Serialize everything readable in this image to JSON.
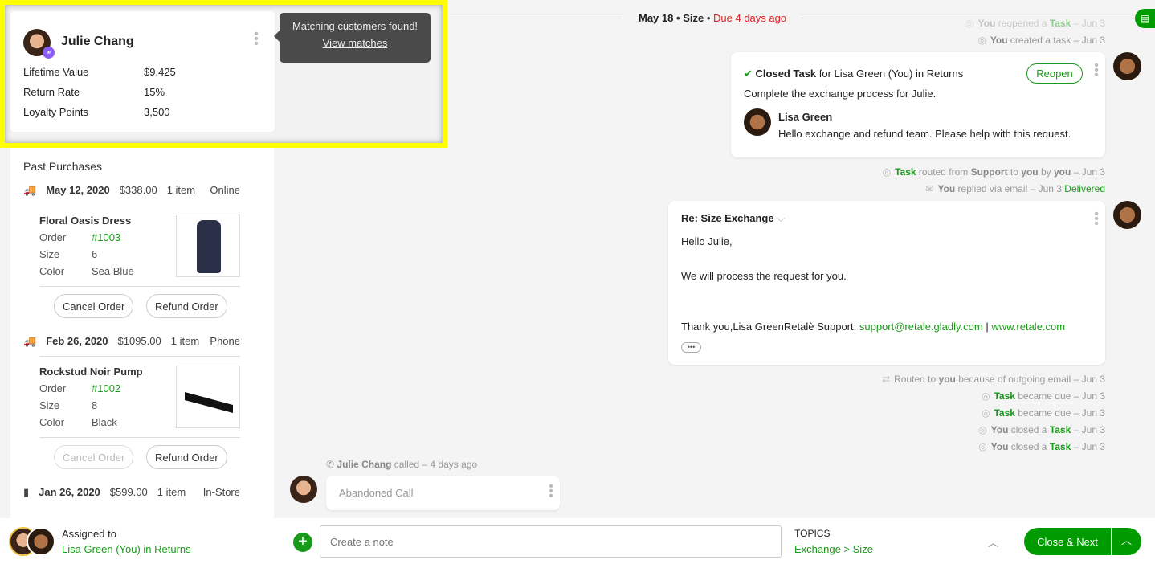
{
  "customer": {
    "name": "Julie Chang",
    "fields": [
      {
        "label": "Lifetime Value",
        "value": "$9,425"
      },
      {
        "label": "Return Rate",
        "value": "15%"
      },
      {
        "label": "Loyalty Points",
        "value": "3,500"
      }
    ]
  },
  "tooltip": {
    "text": "Matching customers found!",
    "link": "View matches"
  },
  "purchases": {
    "title": "Past Purchases",
    "orders": [
      {
        "date": "May 12, 2020",
        "amount": "$338.00",
        "count": "1 item",
        "channel": "Online",
        "icon": "truck-icon",
        "item": "Floral Oasis Dress",
        "order_label": "Order",
        "order": "#1003",
        "size_label": "Size",
        "size": "6",
        "color_label": "Color",
        "color": "Sea Blue",
        "cancel": "Cancel Order",
        "refund": "Refund Order"
      },
      {
        "date": "Feb 26, 2020",
        "amount": "$1095.00",
        "count": "1 item",
        "channel": "Phone",
        "icon": "truck-icon",
        "item": "Rockstud Noir Pump",
        "order_label": "Order",
        "order": "#1002",
        "size_label": "Size",
        "size": "8",
        "color_label": "Color",
        "color": "Black",
        "cancel": "Cancel Order",
        "refund": "Refund Order"
      },
      {
        "date": "Jan 26, 2020",
        "amount": "$599.00",
        "count": "1 item",
        "channel": "In-Store",
        "icon": "store-icon"
      }
    ]
  },
  "header": {
    "date": "May 18",
    "sep": "•",
    "topic": "Size",
    "due": "Due 4 days ago"
  },
  "timeline_top": [
    [
      [
        "b",
        "You"
      ],
      [
        "t",
        " reopened a "
      ],
      [
        "g",
        "Task"
      ],
      [
        "t",
        " – Jun 3"
      ]
    ],
    [
      [
        "b",
        "You"
      ],
      [
        "t",
        " created a task – Jun 3"
      ]
    ]
  ],
  "task_card": {
    "title_bold": "Closed Task",
    "title_rest": " for Lisa Green (You) in Returns",
    "reopen": "Reopen",
    "description": "Complete the exchange process for Julie.",
    "author": "Lisa Green",
    "comment": "Hello exchange and refund team. Please help with this request."
  },
  "timeline_mid": [
    [
      [
        "g",
        "Task"
      ],
      [
        "t",
        " routed from "
      ],
      [
        "b",
        "Support"
      ],
      [
        "t",
        " to "
      ],
      [
        "b",
        "you"
      ],
      [
        "t",
        " by "
      ],
      [
        "b",
        "you"
      ],
      [
        "t",
        " – Jun 3"
      ]
    ],
    [
      [
        "b",
        "You"
      ],
      [
        "t",
        " replied via email – Jun 3 "
      ],
      [
        "gd",
        "Delivered"
      ]
    ]
  ],
  "email": {
    "subject": "Re: Size Exchange",
    "greeting": "Hello Julie,",
    "body": "We will process the request for you.",
    "signoff": "Thank you,Lisa GreenRetalè Support: ",
    "email": "support@retale.gladly.com",
    "sep": " | ",
    "site": "www.retale.com"
  },
  "timeline_bottom": [
    [
      [
        "t",
        "Routed to "
      ],
      [
        "b",
        "you"
      ],
      [
        "t",
        " because of outgoing email – Jun 3"
      ]
    ],
    [
      [
        "g",
        "Task"
      ],
      [
        "t",
        " became due – Jun 3"
      ]
    ],
    [
      [
        "g",
        "Task"
      ],
      [
        "t",
        " became due – Jun 3"
      ]
    ],
    [
      [
        "b",
        "You"
      ],
      [
        "t",
        " closed a "
      ],
      [
        "g",
        "Task"
      ],
      [
        "t",
        " – Jun 3"
      ]
    ],
    [
      [
        "b",
        "You"
      ],
      [
        "t",
        " closed a "
      ],
      [
        "g",
        "Task"
      ],
      [
        "t",
        " – Jun 3"
      ]
    ]
  ],
  "call": {
    "caller": "Julie Chang",
    "rest": " called – 4 days ago",
    "label": "Abandoned Call"
  },
  "footer": {
    "assigned_label": "Assigned to",
    "assignee": "Lisa Green (You) in Returns",
    "note_placeholder": "Create a note",
    "topics_label": "TOPICS",
    "topics_value": "Exchange > Size",
    "close_next": "Close & Next"
  },
  "colors": {
    "accent": "#009b00",
    "due": "#e02020",
    "highlight": "#ffff00",
    "badge": "#8b5cf6"
  }
}
